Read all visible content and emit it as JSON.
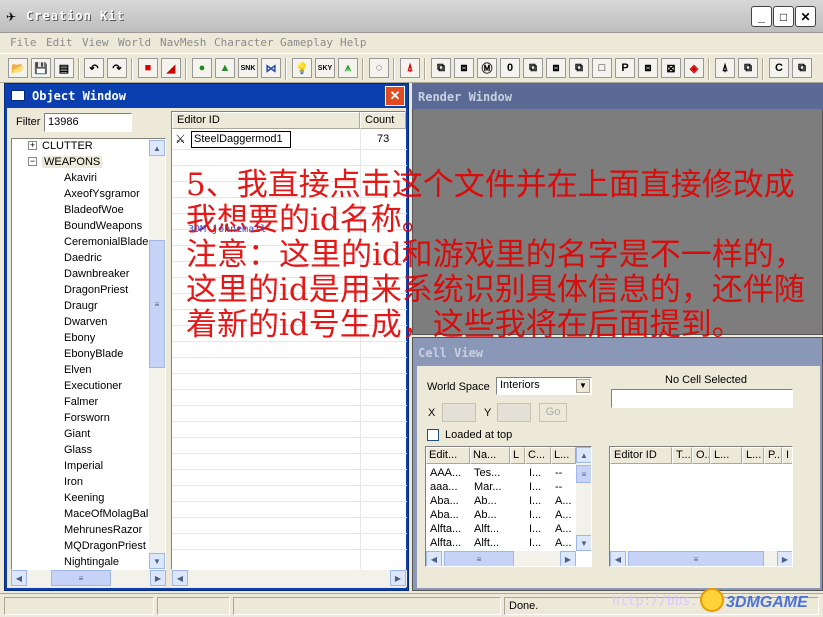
{
  "app": {
    "title": "Creation Kit"
  },
  "menubar": [
    "File",
    "Edit",
    "View",
    "World",
    "NavMesh",
    "Character",
    "Gameplay",
    "Help"
  ],
  "object_window": {
    "title": "Object Window",
    "filter_label": "Filter",
    "filter_value": "13986",
    "tree": {
      "clutter": "CLUTTER",
      "weapons": "WEAPONS",
      "children": [
        "Akaviri",
        "AxeofYsgramor",
        "BladeofWoe",
        "BoundWeapons",
        "CeremonialBlade",
        "Daedric",
        "Dawnbreaker",
        "DragonPriest",
        "Draugr",
        "Dwarven",
        "Ebony",
        "EbonyBlade",
        "Elven",
        "Executioner",
        "Falmer",
        "Forsworn",
        "Giant",
        "Glass",
        "Imperial",
        "Iron",
        "Keening",
        "MaceOfMolagBal",
        "MehrunesRazor",
        "MQDragonPriest",
        "Nightingale"
      ]
    },
    "list": {
      "col_editor_id": "Editor ID",
      "col_count": "Count",
      "row_id": "SteelDaggermod1",
      "row_count": "73"
    }
  },
  "render_window": {
    "title": "Render Window"
  },
  "cell_view": {
    "title": "Cell View",
    "worldspace_label": "World Space",
    "worldspace_value": "Interiors",
    "no_cell": "No Cell Selected",
    "x_label": "X",
    "y_label": "Y",
    "go_label": "Go",
    "loaded_at_top": "Loaded at top",
    "left_headers": [
      "Edit...",
      "Na...",
      "L",
      "C...",
      "L..."
    ],
    "left_rows": [
      [
        "AAA...",
        "Tes...",
        "",
        "I...",
        "--"
      ],
      [
        "aaa...",
        "Mar...",
        "",
        "I...",
        "--"
      ],
      [
        "Aba...",
        "Ab...",
        "",
        "I...",
        "A..."
      ],
      [
        "Aba...",
        "Ab...",
        "",
        "I...",
        "A..."
      ],
      [
        "Alfta...",
        "Alft...",
        "",
        "I...",
        "A..."
      ],
      [
        "Alfta...",
        "Alft...",
        "",
        "I...",
        "A..."
      ]
    ],
    "right_headers": [
      "Editor ID",
      "T...",
      "O...",
      "L...",
      "L...",
      "P...",
      "I"
    ]
  },
  "statusbar": {
    "done": "Done."
  },
  "annotation": "5、我直接点击这个文件并在上面直接修改成我想要的id名称。\n注意：这里的id和游戏里的名字是不一样的，这里的id是用来系统识别具体信息的，还伴随着新的id号生成，这些我将在后面提到。",
  "watermarks": {
    "inline": "3DM johnemail",
    "url": "http://bbs.",
    "brand": "3DMGAME"
  }
}
